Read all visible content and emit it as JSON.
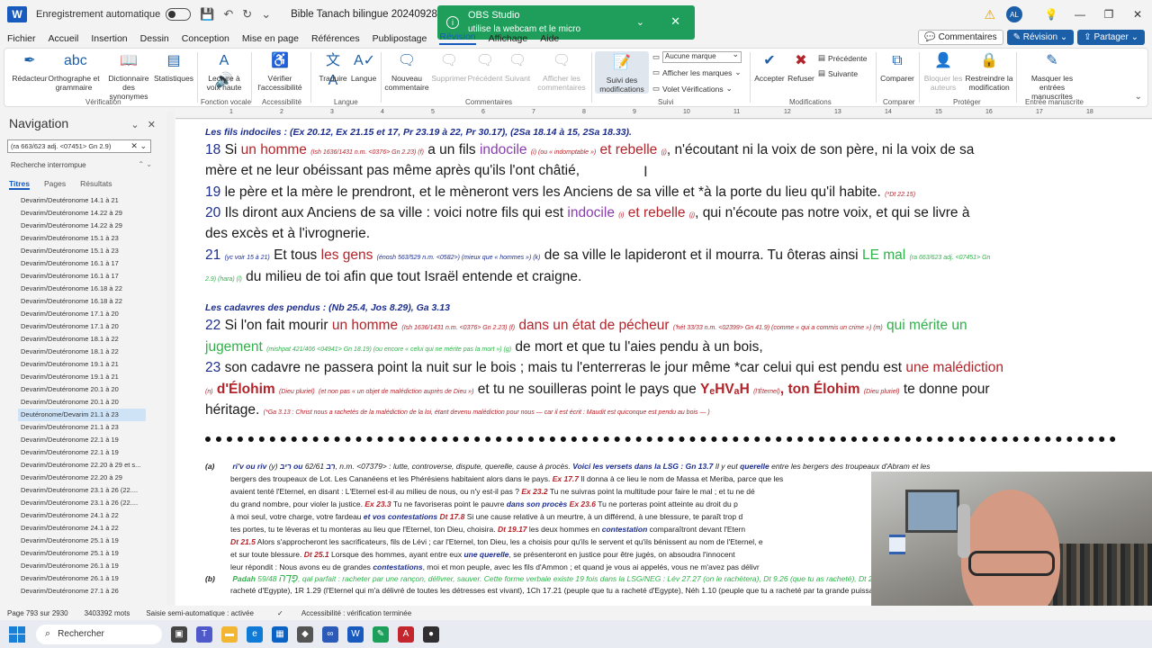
{
  "titlebar": {
    "autosave_label": "Enregistrement automatique",
    "doc_title": "Bible Tanach bilingue 20240928de20240927.docx",
    "avatar_initials": "AL"
  },
  "toast": {
    "title": "OBS Studio",
    "message": "utilise la webcam et le micro"
  },
  "menu": {
    "items": [
      "Fichier",
      "Accueil",
      "Insertion",
      "Dessin",
      "Conception",
      "Mise en page",
      "Références",
      "Publipostage",
      "Révision",
      "Affichage",
      "Aide"
    ],
    "active": "Révision",
    "comments_btn": "Commentaires",
    "revision_btn": "Révision",
    "share_btn": "Partager"
  },
  "ribbon": {
    "buttons": [
      {
        "label": "Rédacteur"
      },
      {
        "label": "Orthographe et grammaire"
      },
      {
        "label": "Dictionnaire des synonymes"
      },
      {
        "label": "Statistiques"
      },
      {
        "label": "Lecture à voix haute"
      },
      {
        "label": "Vérifier l'accessibilité"
      },
      {
        "label": "Traduire"
      },
      {
        "label": "Langue"
      },
      {
        "label": "Nouveau commentaire"
      },
      {
        "label": "Supprimer"
      },
      {
        "label": "Précédent"
      },
      {
        "label": "Suivant"
      },
      {
        "label": "Afficher les commentaires"
      },
      {
        "label": "Suivi des modifications"
      },
      {
        "label": "Accepter"
      },
      {
        "label": "Refuser"
      },
      {
        "label": "Comparer"
      },
      {
        "label": "Bloquer les auteurs"
      },
      {
        "label": "Restreindre la modification"
      },
      {
        "label": "Masquer les entrées manuscrites"
      }
    ],
    "markup_dropdown": "Aucune marque",
    "show_markup": "Afficher les marques",
    "review_pane": "Volet Vérifications",
    "prev_change": "Précédente",
    "next_change": "Suivante",
    "groups": [
      "Vérification",
      "Fonction vocale",
      "Accessibilité",
      "Langue",
      "Commentaires",
      "Suivi",
      "Modifications",
      "Comparer",
      "Protéger",
      "Entrée manuscrite"
    ]
  },
  "nav": {
    "title": "Navigation",
    "search_value": "(ra 663/623 adj. <07451> Gn 2.9)",
    "status": "Recherche interrompue",
    "tabs": [
      "Titres",
      "Pages",
      "Résultats"
    ],
    "items": [
      "Devarim/Deutéronome 14.1 à 21",
      "Devarim/Deutéronome 14.22 à 29",
      "Devarim/Deutéronome 14.22 à 29",
      "Devarim/Deutéronome 15.1 à 23",
      "Devarim/Deutéronome 15.1 à 23",
      "Devarim/Deutéronome 16.1 à 17",
      "Devarim/Deutéronome 16.1 à 17",
      "Devarim/Deutéronome 16.18 à 22",
      "Devarim/Deutéronome 16.18 à 22",
      "Devarim/Deutéronome 17.1 à 20",
      "Devarim/Deutéronome 17.1 à 20",
      "Devarim/Deutéronome 18.1 à 22",
      "Devarim/Deutéronome 18.1 à 22",
      "Devarim/Deutéronome 19.1 à 21",
      "Devarim/Deutéronome 19.1 à 21",
      "Devarim/Deutéronome 20.1 à 20",
      "Devarim/Deutéronome 20.1 à 20",
      "Deutéronome/Devarim 21.1 à 23",
      "Devarim/Deutéronome 21.1 à 23",
      "Devarim/Deutéronome 22.1 à 19",
      "Devarim/Deutéronome 22.1 à 19",
      "Devarim/Deutéronome 22.20 à 29 et s...",
      "Devarim/Deutéronome 22.20 à 29",
      "Devarim/Deutéronome 23.1 à 26 (22....",
      "Devarim/Deutéronome 23.1 à 26 (22....",
      "Devarim/Deutéronome 24.1 à 22",
      "Devarim/Deutéronome 24.1 à 22",
      "Devarim/Deutéronome 25.1 à 19",
      "Devarim/Deutéronome 25.1 à 19",
      "Devarim/Deutéronome 26.1 à 19",
      "Devarim/Deutéronome 26.1 à 19",
      "Devarim/Deutéronome 27.1 à 26"
    ]
  },
  "ruler": {
    "ticks": [
      "1",
      "2",
      "3",
      "4",
      "5",
      "6",
      "7",
      "8",
      "9",
      "10",
      "11",
      "12",
      "13",
      "14",
      "15",
      "16",
      "17",
      "18"
    ]
  },
  "doc": {
    "head1": "Les fils indociles : (Ex 20.12, Ex 21.15 et 17, Pr 23.19 à 22, Pr 30.17), (2Sa 18.14 à 15, 2Sa 18.33).",
    "v18a_num": "18",
    "v18a_1": "Si",
    "v18a_2": "un homme",
    "v18a_3": "(Ish 1636/1431 n.m. <0376> Gn 2.23) (f)",
    "v18a_4": "a un fils",
    "v18a_5": "indocile",
    "v18a_6": "(i) (ou « indomptable »)",
    "v18a_7": "et rebelle",
    "v18a_8": "(j)",
    "v18a_9": ", n'écoutant ni la voix de son père, ni la voix de sa",
    "v18b": "mère et ne leur obéissant pas même après qu'ils l'ont châtié,",
    "v19_num": "19",
    "v19_1": "le père et la mère le prendront, et le mèneront vers les Anciens de sa ville et *à la porte du lieu qu'il habite.",
    "v19_2": "(*Dt 22.15)",
    "v20_num": "20",
    "v20_1": "Ils diront aux Anciens de sa ville : voici notre fils qui est",
    "v20_2": "indocile",
    "v20_3": "(i)",
    "v20_4": "et rebelle",
    "v20_5": "(j)",
    "v20_6": ", qui n'écoute pas notre voix, et qui se livre à",
    "v20b": "des excès et à l'ivrognerie.",
    "v21_num": "21",
    "v21_1": "Et tous",
    "v21_2": "(yc voir 15 à 21)",
    "v21_3": "les gens",
    "v21_4": "(énosh 563/529 n.m. <0582>) (mieux que « hommes ») (k)",
    "v21_5": "de sa ville le lapideront et il mourra. Tu ôteras ainsi",
    "v21_6": "LE mal",
    "v21_7": "(ra 663/623 adj. <07451> Gn",
    "v21b_1": "2.9) (hara) (l)",
    "v21b_2": "du milieu de toi afin que tout Israël entende et craigne.",
    "head2": "Les cadavres des pendus : (Nb 25.4, Jos 8.29), Ga 3.13",
    "v22_num": "22",
    "v22_1": "Si l'on fait mourir",
    "v22_2": "un homme",
    "v22_3": "(Ish 1636/1431 n.m. <0376> Gn 2.23) (f)",
    "v22_4": "dans un état de pécheur",
    "v22_5": "('hét 33/33 n.m. <02399> Gn 41.9) (comme « qui a commis un crime ») (m)",
    "v22_6": "qui mérite un",
    "v22b_1": "jugement",
    "v22b_2": "(mishpat 421/406 <04941> Gn 18.19) (ou encore « celui qui ne mérite pas la mort ») (g)",
    "v22b_3": "de mort et que tu l'aies pendu à un bois,",
    "v23_num": "23",
    "v23_1": "son cadavre ne passera point la nuit sur le bois ; mais tu l'enterreras le jour même *car celui qui est pendu est",
    "v23_2": "une malédiction",
    "v23b_1": "(n)",
    "v23b_2": "d'Élohim",
    "v23b_3": "(Dieu pluriel)",
    "v23b_4": "(et non pas « un objet de malédiction auprès de Dieu »)",
    "v23b_5": "et tu ne souilleras point le pays que",
    "v23b_6": "YₑHVₐH",
    "v23b_7": "(l'Éternel)",
    "v23b_8": ", ton Élohim",
    "v23b_9": "(Dieu pluriel)",
    "v23b_10": "te donne pour",
    "v23c_1": "héritage.",
    "v23c_2": "(*Ga 3.13 : Christ nous a rachetés de la malédiction de la loi, étant devenu malédiction pour nous — car il est écrit : Maudit est quiconque est pendu au bois — )",
    "fn_a_label": "(a)",
    "fn_a_1": "ri'v ou riv",
    "fn_a_2": "(y)",
    "fn_a_3": "רִיב ou רִב",
    "fn_a_4": "62/61, n.m. <07379> : lutte, controverse, dispute, querelle, cause à procès.",
    "fn_a_5": "Voici les versets dans la LSG : Gn 13.7",
    "fn_a_6": "Il y eut",
    "fn_a_7": "querelle",
    "fn_a_8": "entre les bergers des troupeaux d'Abram et les",
    "fn_a_l2": "bergers des troupeaux de Lot. Les Cananéens et les Phérésiens habitaient alors dans le pays.",
    "fn_a_l2b": "Ex 17.7",
    "fn_a_l2c": "Il donna à ce lieu le nom de Massa et Meriba, parce que les",
    "fn_a_l3": "avaient tenté l'Eternel, en disant : L'Eternel est-il au milieu de nous, ou n'y est-il pas ?",
    "fn_a_l3b": "Ex 23.2",
    "fn_a_l3c": "Tu ne suivras point la multitude pour faire le mal ; et tu ne dé",
    "fn_a_l4": "du grand nombre, pour violer la justice.",
    "fn_a_l4b": "Ex 23.3",
    "fn_a_l4c": "Tu ne favoriseras point le pauvre",
    "fn_a_l4d": "dans son procès",
    "fn_a_l4e": "Ex 23.6",
    "fn_a_l4f": "Tu ne porteras point atteinte au droit du p",
    "fn_a_l5": "à moi seul, votre charge, votre fardeau",
    "fn_a_l5b": "et vos contestations",
    "fn_a_l5c": "Dt 17.8",
    "fn_a_l5d": "Si une cause relative à un meurtre, à un différend, à une blessure, te paraît trop d",
    "fn_a_l6": "tes portes, tu te lèveras et tu monteras au lieu que l'Eternel, ton Dieu, choisira.",
    "fn_a_l6b": "Dt 19.17",
    "fn_a_l6c": "les deux hommes en",
    "fn_a_l6d": "contestation",
    "fn_a_l6e": "comparaîtront devant l'Etern",
    "fn_a_l7": "Dt 21.5",
    "fn_a_l7b": "Alors s'approcheront les sacrificateurs, fils de Lévi ; car l'Eternel, ton Dieu, les a choisis pour qu'ils le servent et qu'ils bénissent au nom de l'Eternel, e",
    "fn_a_l8": "et sur toute blessure.",
    "fn_a_l8b": "Dt 25.1",
    "fn_a_l8c": "Lorsque des hommes, ayant entre eux",
    "fn_a_l8d": "une querelle",
    "fn_a_l8e": ", se présenteront en justice pour être jugés, on absoudra l'innocent",
    "fn_a_l9": "leur répondit : Nous avons eu de grandes",
    "fn_a_l9b": "contestations",
    "fn_a_l9c": ", moi et mon peuple, avec les fils d'Ammon ; et quand je vous ai appelés, vous ne m'avez pas délivr",
    "fn_b_label": "(b)",
    "fn_b_1": "Padah",
    "fn_b_2": "פָּדָה",
    "fn_b_3": "59/48, qal parfait : racheter par une rançon, délivrer, sauver. Cette forme verbale existe 19 fois dans la LSG/NEG : Lév 27.27",
    "fn_b_4": "(on le rachètera), Dt 9.26 (que tu as racheté), Dt 21.8",
    "fn_b_l2": "racheté d'Egypte), 1R 1.29 (l'Eternel qui m'a délivré de toutes les détresses est vivant), 1Ch 17.21 (peuple que tu a racheté d'Egypte), Néh 1.10 (peuple que tu a racheté par ta grande puissance et par"
  },
  "statusbar": {
    "page": "Page 793 sur 2930",
    "words": "3403392 mots",
    "input": "Saisie semi-automatique : activée",
    "accessibility": "Accessibilité : vérification terminée"
  },
  "taskbar": {
    "search": "Rechercher"
  },
  "colors": {
    "word_blue": "#185abd",
    "obs_green": "#1e9e5a",
    "verse_red": "#b3232a",
    "verse_purple": "#8a3db0",
    "verse_green": "#2fb24a",
    "verse_blue": "#1c2d8e"
  }
}
